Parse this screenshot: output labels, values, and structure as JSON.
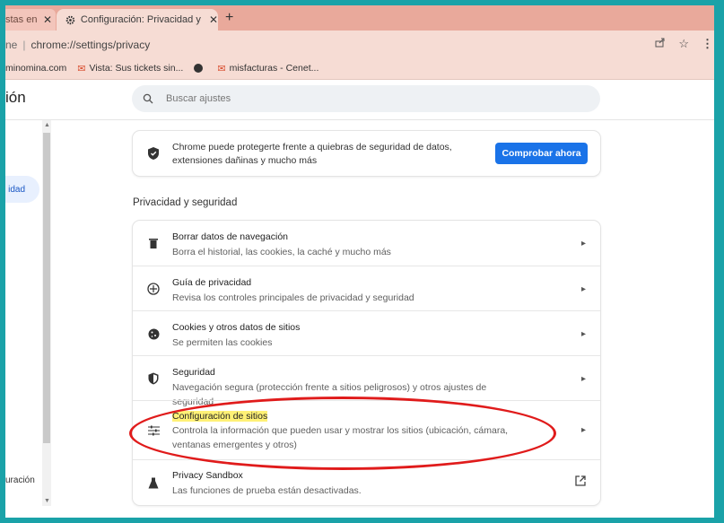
{
  "tabs": [
    {
      "label": "stas en",
      "close": "✕"
    },
    {
      "label": "Configuración: Privacidad y segu",
      "close": "✕"
    }
  ],
  "new_tab": "+",
  "address": {
    "prefix": "ne",
    "url": "chrome://settings/privacy"
  },
  "bookmarks": [
    {
      "label": "minomina.com"
    },
    {
      "label": "Vista: Sus tickets sin..."
    },
    {
      "label": ""
    },
    {
      "label": "misfacturas - Cenet..."
    }
  ],
  "header": {
    "title": "ión",
    "search_placeholder": "Buscar ajustes"
  },
  "sidebar": {
    "selected_item": "idad",
    "bottom_item": "uración"
  },
  "safety_check": {
    "text": "Chrome puede protegerte frente a quiebras de seguridad de datos, extensiones dañinas y mucho más",
    "button": "Comprobar ahora"
  },
  "section": {
    "title": "Privacidad y seguridad"
  },
  "items": [
    {
      "title": "Borrar datos de navegación",
      "subtitle": "Borra el historial, las cookies, la caché y mucho más",
      "icon": "trash-icon"
    },
    {
      "title": "Guía de privacidad",
      "subtitle": "Revisa los controles principales de privacidad y seguridad",
      "icon": "compass-icon"
    },
    {
      "title": "Cookies y otros datos de sitios",
      "subtitle": "Se permiten las cookies",
      "icon": "cookie-icon"
    },
    {
      "title": "Seguridad",
      "subtitle": "Navegación segura (protección frente a sitios peligrosos) y otros ajustes de seguridad",
      "icon": "shield-icon"
    },
    {
      "title": "Configuración de sitios",
      "subtitle": "Controla la información que pueden usar y mostrar los sitios (ubicación, cámara, ventanas emergentes y otros)",
      "icon": "sliders-icon"
    },
    {
      "title": "Privacy Sandbox",
      "subtitle": "Las funciones de prueba están desactivadas.",
      "icon": "flask-icon"
    }
  ],
  "colors": {
    "accent": "#1a73e8",
    "annotation": "#e01b1b",
    "highlight": "#fff176",
    "tabbar": "#e9a99b",
    "frame": "#1aa2a8"
  }
}
